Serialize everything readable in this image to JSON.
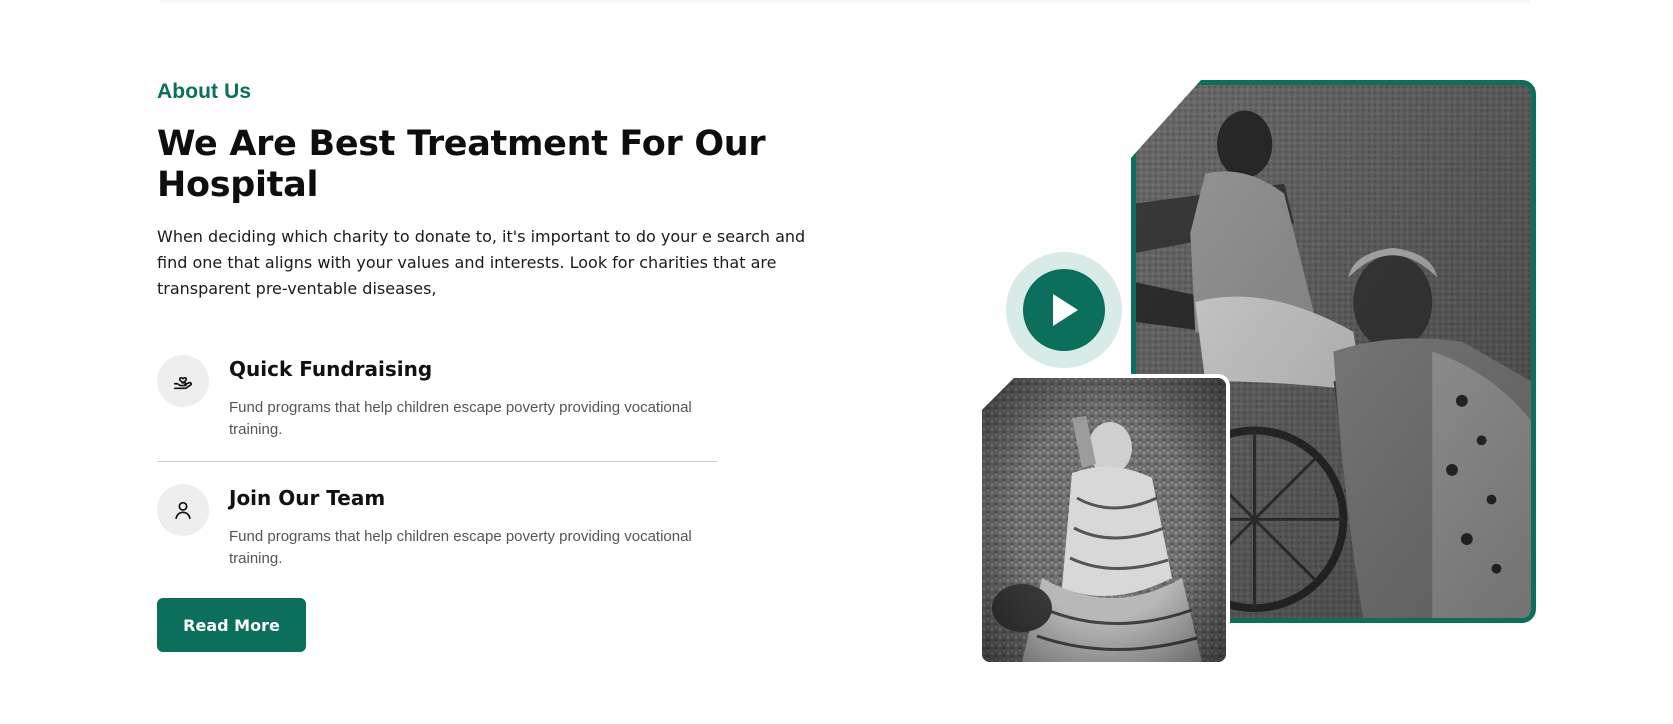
{
  "about": {
    "eyebrow": "About Us",
    "title": "We Are Best Treatment For Our Hospital",
    "intro": "When deciding which charity to donate to, it's important to do your e search and find one that aligns with your values and interests. Look for charities that are transparent pre-ventable diseases,"
  },
  "features": [
    {
      "icon": "hand-heart-icon",
      "title": "Quick Fundraising",
      "description": "Fund programs that help children escape poverty providing vocational training."
    },
    {
      "icon": "user-icon",
      "title": "Join Our Team",
      "description": "Fund programs that help children escape poverty providing vocational training."
    }
  ],
  "cta": {
    "read_more_label": "Read More"
  },
  "media": {
    "play_icon": "play-icon",
    "main_image": "photo-girl-and-woman",
    "secondary_image": "photo-elderly-woman-seated"
  },
  "colors": {
    "accent": "#0b6f5c",
    "accent_soft": "#d9ebe6",
    "icon_bg": "#eeeeee",
    "text_dark": "#111111",
    "text_muted": "#555555"
  }
}
